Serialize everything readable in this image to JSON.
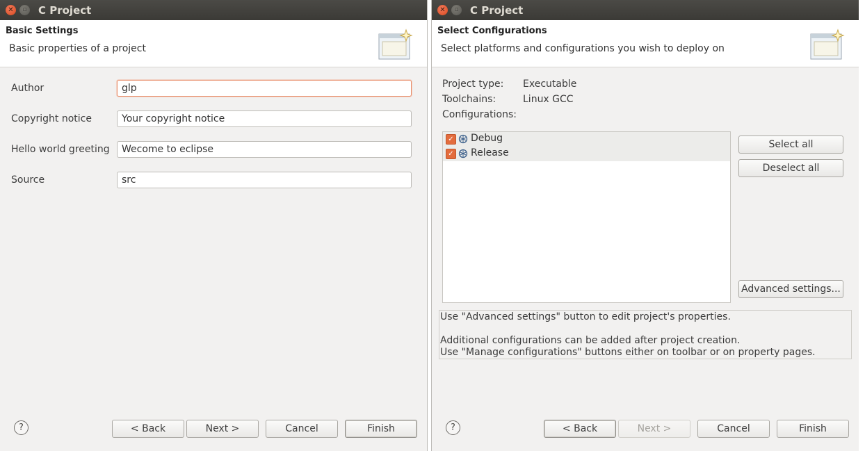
{
  "left": {
    "window_title": "C Project",
    "header": {
      "title": "Basic Settings",
      "description": "Basic properties of a project"
    },
    "fields": [
      {
        "label": "Author",
        "value": "glp"
      },
      {
        "label": "Copyright notice",
        "value": "Your copyright notice"
      },
      {
        "label": "Hello world greeting",
        "value": "Wecome to eclipse"
      },
      {
        "label": "Source",
        "value": "src"
      }
    ],
    "buttons": {
      "back": "< Back",
      "next": "Next >",
      "cancel": "Cancel",
      "finish": "Finish"
    },
    "help": "?"
  },
  "right": {
    "window_title": "C Project",
    "header": {
      "title": "Select Configurations",
      "description": "Select platforms and configurations you wish to deploy on"
    },
    "info": {
      "project_type_label": "Project type:",
      "project_type_value": "Executable",
      "toolchains_label": "Toolchains:",
      "toolchains_value": "Linux GCC",
      "configurations_label": "Configurations:"
    },
    "configurations": [
      {
        "name": "Debug",
        "checked": true
      },
      {
        "name": "Release",
        "checked": true
      }
    ],
    "side_buttons": {
      "select_all": "Select all",
      "deselect_all": "Deselect all",
      "advanced": "Advanced settings..."
    },
    "message": {
      "line1": "Use \"Advanced settings\" button to edit project's properties.",
      "line2": "Additional configurations can be added after project creation.",
      "line3": "Use \"Manage configurations\" buttons either on toolbar or on property pages."
    },
    "buttons": {
      "back": "< Back",
      "next": "Next >",
      "cancel": "Cancel",
      "finish": "Finish"
    },
    "help": "?"
  },
  "colors": {
    "titlebar": "#3c3b37",
    "checkbox": "#e36c3d",
    "focus_border": "#e88e6b",
    "dialog_bg": "#f2f1f0"
  },
  "icons": [
    "close-icon",
    "maximize-icon",
    "wizard-banner-icon",
    "help-icon",
    "configuration-icon",
    "checkbox-checked-icon"
  ]
}
